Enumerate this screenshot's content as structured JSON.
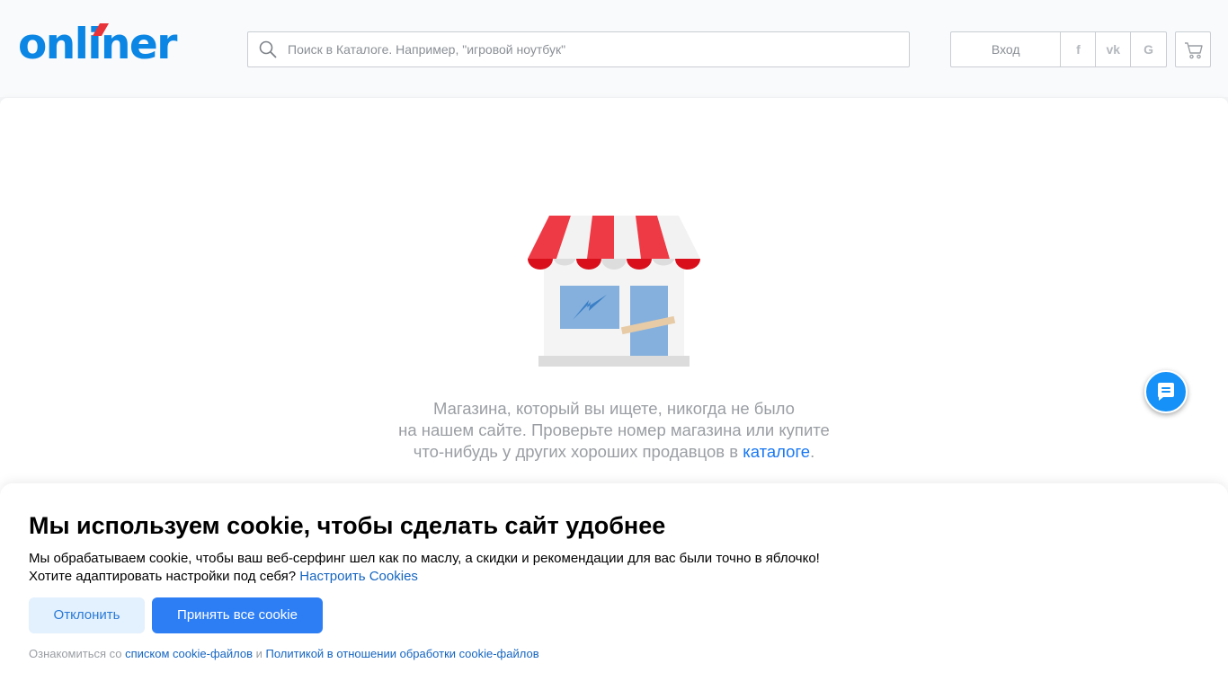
{
  "header": {
    "logo_text": "onliner",
    "search": {
      "placeholder": "Поиск в Каталоге. Например, \"игровой ноутбук\"",
      "value": ""
    },
    "auth": {
      "login_label": "Вход",
      "facebook_glyph": "f",
      "vk_glyph": "vk",
      "google_glyph": "G"
    }
  },
  "main": {
    "message_line1": "Магазина, который вы ищете, никогда не было",
    "message_line2": "на нашем сайте. Проверьте номер магазина или купите",
    "message_line3_prefix": "что-нибудь у других хороших продавцов в ",
    "catalog_link": "каталоге",
    "message_suffix": "."
  },
  "cookie": {
    "title": "Мы используем cookie, чтобы сделать сайт удобнее",
    "text_line1": "Мы обрабатываем cookie, чтобы ваш веб-серфинг шел как по маслу, а скидки и рекомендации для вас были точно в яблочко!",
    "text_line2_prefix": "Хотите адаптировать настройки под себя? ",
    "settings_link": "Настроить Cookies",
    "decline_label": "Отклонить",
    "accept_label": "Принять все cookie",
    "footer_prefix": "Ознакомиться со ",
    "footer_link1": "списком cookie-файлов",
    "footer_and": " и ",
    "footer_link2": "Политикой в отношении обработки cookie-файлов"
  },
  "colors": {
    "brand_blue": "#0b86e5",
    "brand_red": "#e8333a",
    "accept_button": "#2d7ef5",
    "decline_button": "#e3f0fd",
    "link": "#1565c0"
  },
  "icons": [
    "search-icon",
    "facebook-icon",
    "vk-icon",
    "google-icon",
    "cart-icon",
    "chat-icon",
    "shop-illustration"
  ]
}
